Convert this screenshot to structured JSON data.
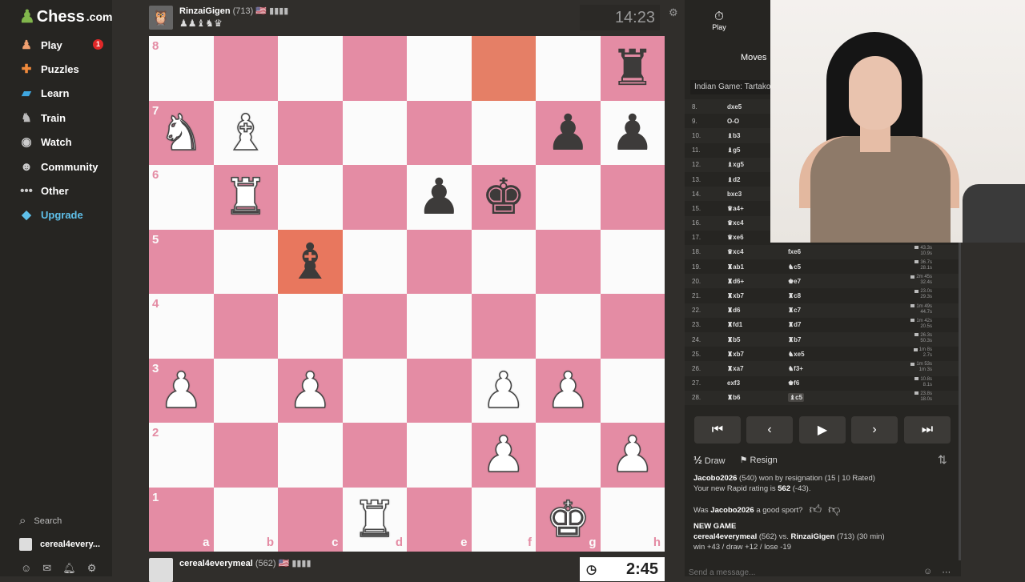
{
  "sidebar": {
    "logo_text": "Chess",
    "logo_tld": ".com",
    "items": [
      {
        "label": "Play",
        "icon": "play-pawn-icon",
        "badge": "1"
      },
      {
        "label": "Puzzles",
        "icon": "puzzle-icon"
      },
      {
        "label": "Learn",
        "icon": "learn-cap-icon"
      },
      {
        "label": "Train",
        "icon": "train-icon"
      },
      {
        "label": "Watch",
        "icon": "watch-binoculars-icon"
      },
      {
        "label": "Community",
        "icon": "community-icon"
      },
      {
        "label": "Other",
        "icon": "more-dots-icon"
      },
      {
        "label": "Upgrade",
        "icon": "diamond-icon"
      }
    ],
    "search_label": "Search",
    "username": "cereal4every...",
    "footer_badges": [
      "1",
      "1"
    ]
  },
  "top_player": {
    "name": "RinzaiGigen",
    "rating": "(713)",
    "flag": "🇺🇸",
    "captured": "♟♟♝♞♛",
    "clock": "14:23"
  },
  "bottom_player": {
    "name": "cereal4everymeal",
    "rating": "(562)",
    "flag": "🇺🇸",
    "clock": "2:45"
  },
  "board": {
    "ranks": [
      "8",
      "7",
      "6",
      "5",
      "4",
      "3",
      "2",
      "1"
    ],
    "files": [
      "a",
      "b",
      "c",
      "d",
      "e",
      "f",
      "g",
      "h"
    ],
    "pieces": {
      "h8": "♜b",
      "a7": "♞w",
      "b7": "♝w",
      "g7": "♟b",
      "h7": "♟b",
      "b6": "♜w",
      "e6": "♟b",
      "f6": "♚b",
      "c5": "♝b",
      "a3": "♟w",
      "c3": "♟w",
      "f3": "♟w",
      "g3": "♟w",
      "f2": "♟w",
      "h2": "♟w",
      "d1": "♜w",
      "g1": "♚w"
    },
    "highlights": [
      "f8",
      "c5"
    ]
  },
  "panel": {
    "tab_play": "Play",
    "tab_moves": "Moves",
    "opening": "Indian Game: Tartakov",
    "moves": [
      {
        "n": "8.",
        "w": "dxe5",
        "b": ""
      },
      {
        "n": "9.",
        "w": "O-O",
        "b": ""
      },
      {
        "n": "10.",
        "w": "♝b3",
        "b": ""
      },
      {
        "n": "11.",
        "w": "♝g5",
        "b": ""
      },
      {
        "n": "12.",
        "w": "♝xg5",
        "b": ""
      },
      {
        "n": "13.",
        "w": "♝d2",
        "b": ""
      },
      {
        "n": "14.",
        "w": "bxc3",
        "b": ""
      },
      {
        "n": "15.",
        "w": "♛a4+",
        "b": ""
      },
      {
        "n": "16.",
        "w": "♛xc4",
        "b": ""
      },
      {
        "n": "17.",
        "w": "♛xe6",
        "b": ""
      },
      {
        "n": "18.",
        "w": "♛xc4",
        "b": "fxe6",
        "t1": "43.3s",
        "t2": "10.9s"
      },
      {
        "n": "19.",
        "w": "♜ab1",
        "b": "♞c5",
        "t1": "36.7s",
        "t2": "28.1s"
      },
      {
        "n": "20.",
        "w": "♜d6+",
        "b": "♚e7",
        "t1": "2m 45s",
        "t2": "32.4s"
      },
      {
        "n": "21.",
        "w": "♜xb7",
        "b": "♜c8",
        "t1": "23.0s",
        "t2": "29.3s"
      },
      {
        "n": "22.",
        "w": "♜d6",
        "b": "♜c7",
        "t1": "1m 49s",
        "t2": "44.7s"
      },
      {
        "n": "23.",
        "w": "♜fd1",
        "b": "♜d7",
        "t1": "1m 42s",
        "t2": "20.5s"
      },
      {
        "n": "24.",
        "w": "♜b5",
        "b": "♜b7",
        "t1": "26.3s",
        "t2": "50.3s"
      },
      {
        "n": "25.",
        "w": "♜xb7",
        "b": "♞xe5",
        "t1": "1m 8s",
        "t2": "2.7s"
      },
      {
        "n": "26.",
        "w": "♜xa7",
        "b": "♞f3+",
        "t1": "1m 53s",
        "t2": "1m 3s"
      },
      {
        "n": "27.",
        "w": "exf3",
        "b": "♚f6",
        "t1": "10.8s",
        "t2": "8.1s"
      },
      {
        "n": "28.",
        "w": "♜b6",
        "b": "♝c5",
        "t1": "23.8s",
        "t2": "18.0s"
      }
    ],
    "draw_label": "Draw",
    "resign_label": "Resign",
    "result_name": "Jacobo2026",
    "result_text": " (540) won by resignation (15 | 10 Rated)",
    "rating_prefix": "Your new Rapid rating is ",
    "rating_value": "562",
    "rating_suffix": " (-43).",
    "sport_prefix": "Was ",
    "sport_name": "Jacobo2026",
    "sport_suffix": " a good sport?",
    "new_game_heading": "NEW GAME",
    "new_game_p1": "cereal4everymeal",
    "new_game_mid": " (562) vs. ",
    "new_game_p2": "RinzaiGigen",
    "new_game_tail": " (713) (30 min)",
    "new_game_stats": "win +43 / draw +12 / lose -19",
    "chat_placeholder": "Send a message..."
  }
}
